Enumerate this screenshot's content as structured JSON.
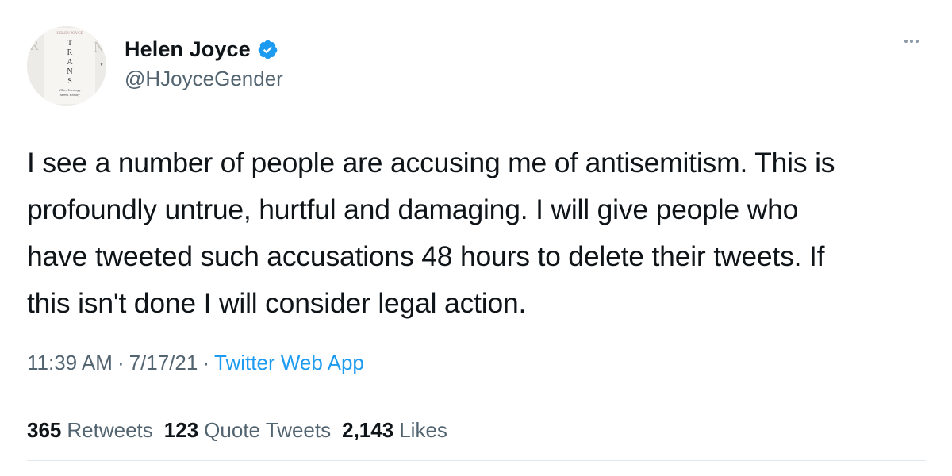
{
  "author": {
    "display_name": "Helen Joyce",
    "handle": "@HJoyceGender",
    "avatar": {
      "cover_author": "HELEN JOYCE",
      "cover_title_letters": [
        "T",
        "R",
        "A",
        "N",
        "S"
      ],
      "cover_subtitle_line1": "When Ideology",
      "cover_subtitle_line2": "Meets Reality"
    },
    "verified_icon": "verified-badge-icon",
    "verified_color": "#1d9bf0"
  },
  "tweet": {
    "lines": [
      "I see a number of people are accusing me of antisemitism. This is",
      "profoundly untrue, hurtful and damaging. I will give people who",
      "have tweeted such accusations 48 hours to delete their tweets. If",
      "this isn't done I will consider legal action."
    ]
  },
  "meta": {
    "time": "11:39 AM",
    "separator1": "·",
    "date": "7/17/21",
    "separator2": "·",
    "source": "Twitter Web App"
  },
  "stats": {
    "retweets_count": "365",
    "retweets_label": "Retweets",
    "quotes_count": "123",
    "quotes_label": "Quote Tweets",
    "likes_count": "2,143",
    "likes_label": "Likes"
  },
  "more_icon": "more-options-icon"
}
